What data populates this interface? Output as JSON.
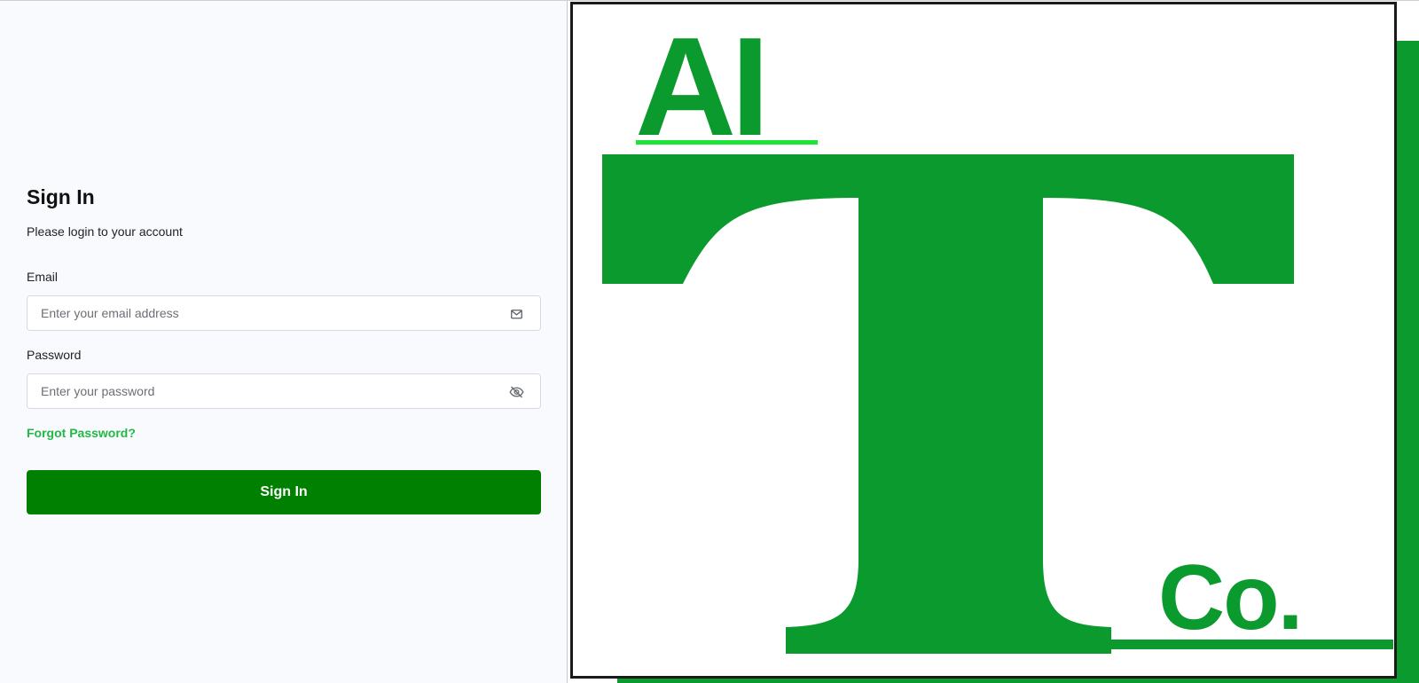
{
  "signin": {
    "title": "Sign In",
    "subtitle": "Please login to your account",
    "email_label": "Email",
    "email_placeholder": "Enter your email address",
    "email_value": "",
    "password_label": "Password",
    "password_placeholder": "Enter your password",
    "password_value": "",
    "forgot_password_label": "Forgot Password?",
    "submit_label": "Sign In",
    "email_icon": "envelope-icon",
    "password_icon": "eye-slash-icon"
  },
  "logo": {
    "top_text": "AI",
    "main_letter": "T",
    "bottom_text": "Co.",
    "brand_color": "#0b9a2d",
    "underline_color": "#1ee43a"
  },
  "colors": {
    "left_background": "#f8fafe",
    "button_background": "#008000",
    "link_color": "#22b845"
  }
}
